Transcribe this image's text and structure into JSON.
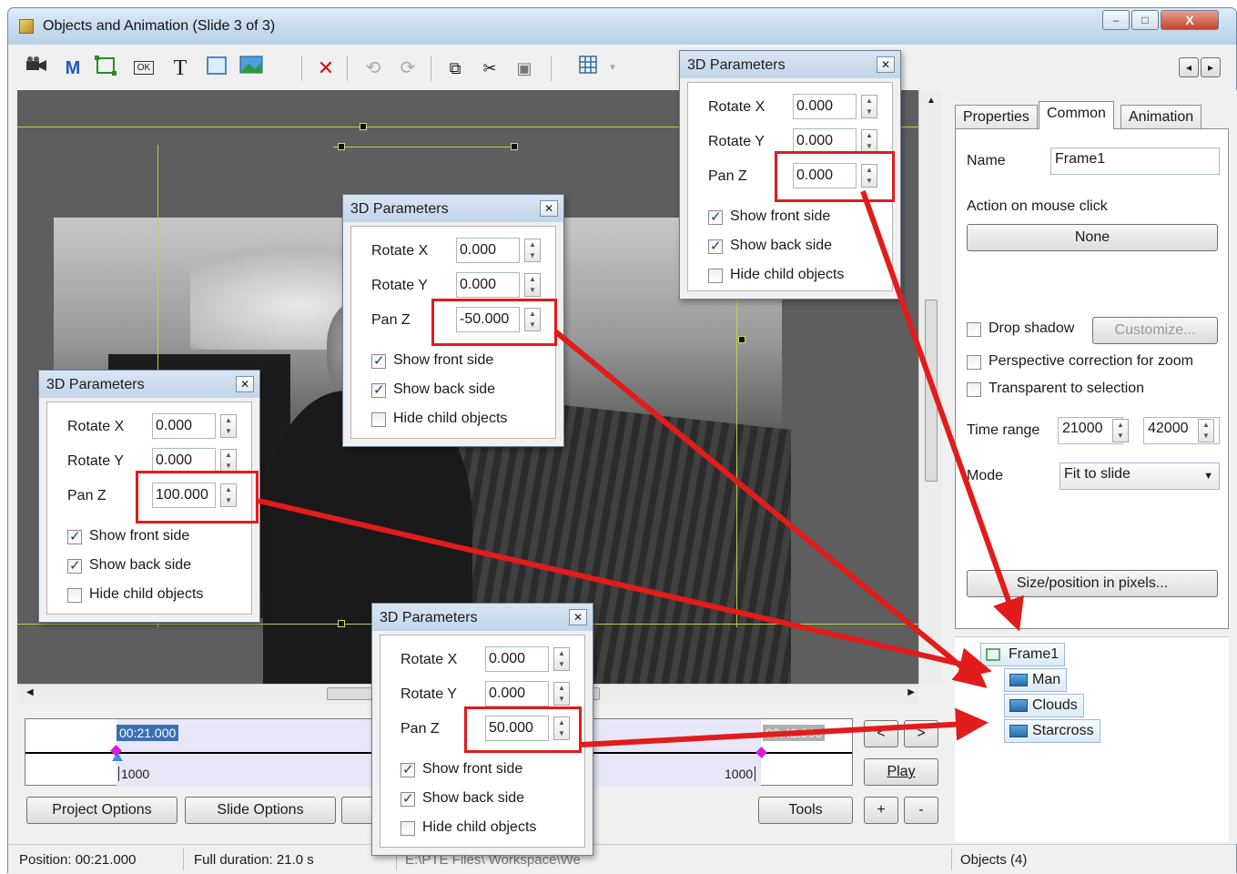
{
  "window": {
    "title": "Objects and Animation  (Slide 3 of 3)",
    "min_label": "–",
    "max_label": "□",
    "close_label": "X"
  },
  "toolbar": {
    "icons": [
      "video-camera-icon",
      "mask-icon",
      "frame-icon",
      "button-icon",
      "text-icon",
      "rectangle-icon",
      "image-icon",
      "delete-icon",
      "undo-icon",
      "redo-icon",
      "copy-icon",
      "cut-icon",
      "paste-icon",
      "grid-icon"
    ],
    "mask_glyph": "M",
    "text_glyph": "T",
    "ok_glyph": "OK",
    "delete_glyph": "✕",
    "nav_prev": "◂",
    "nav_next": "▸"
  },
  "timeline": {
    "start_time": "00:21.000",
    "end_time": "00:42.000",
    "left_value": "1000",
    "right_value": "1000"
  },
  "buttons": {
    "project_options": "Project Options",
    "slide_options": "Slide Options",
    "tools": "Tools",
    "play": "Play",
    "prev": "<",
    "next": ">",
    "plus": "+",
    "minus": "-",
    "none": "None",
    "customize": "Customize...",
    "size_position": "Size/position in pixels..."
  },
  "status": {
    "position": "Position:  00:21.000",
    "duration": "Full duration:  21.0 s",
    "path": "E:\\PTE Files\\ Workspace\\We",
    "objects": "Objects (4)"
  },
  "tabs": [
    "Properties",
    "Common",
    "Animation"
  ],
  "common": {
    "name_label": "Name",
    "name_value": "Frame1",
    "action_label": "Action on mouse click",
    "drop_shadow_label": "Drop shadow",
    "perspective_label": "Perspective correction for zoom",
    "transparent_label": "Transparent to selection",
    "time_range_label": "Time range",
    "time_from": "21000",
    "time_to": "42000",
    "mode_label": "Mode",
    "mode_value": "Fit to slide"
  },
  "tree": [
    {
      "label": "Frame1",
      "icon": "frame-icon"
    },
    {
      "label": "Man",
      "icon": "image-icon"
    },
    {
      "label": "Clouds",
      "icon": "image-icon"
    },
    {
      "label": "Starcross",
      "icon": "image-icon"
    }
  ],
  "dialogs": [
    {
      "title": "3D Parameters",
      "rotate_x_label": "Rotate X",
      "rotate_x": "0.000",
      "rotate_y_label": "Rotate Y",
      "rotate_y": "0.000",
      "pan_z_label": "Pan Z",
      "pan_z": "0.000",
      "show_front_label": "Show front side",
      "show_back_label": "Show back side",
      "hide_child_label": "Hide child objects",
      "show_front": true,
      "show_back": true,
      "hide_child": false
    },
    {
      "title": "3D Parameters",
      "rotate_x_label": "Rotate X",
      "rotate_x": "0.000",
      "rotate_y_label": "Rotate Y",
      "rotate_y": "0.000",
      "pan_z_label": "Pan Z",
      "pan_z": "-50.000",
      "show_front_label": "Show front side",
      "show_back_label": "Show back side",
      "hide_child_label": "Hide child objects",
      "show_front": true,
      "show_back": true,
      "hide_child": false
    },
    {
      "title": "3D Parameters",
      "rotate_x_label": "Rotate X",
      "rotate_x": "0.000",
      "rotate_y_label": "Rotate Y",
      "rotate_y": "0.000",
      "pan_z_label": "Pan Z",
      "pan_z": "100.000",
      "show_front_label": "Show front side",
      "show_back_label": "Show back side",
      "hide_child_label": "Hide child objects",
      "show_front": true,
      "show_back": true,
      "hide_child": false
    },
    {
      "title": "3D Parameters",
      "rotate_x_label": "Rotate X",
      "rotate_x": "0.000",
      "rotate_y_label": "Rotate Y",
      "rotate_y": "0.000",
      "pan_z_label": "Pan Z",
      "pan_z": "50.000",
      "show_front_label": "Show front side",
      "show_back_label": "Show back side",
      "hide_child_label": "Hide child objects",
      "show_front": true,
      "show_back": true,
      "hide_child": false
    }
  ],
  "colors": {
    "annotation_red": "#e21b1b",
    "guide_green": "#b7d548",
    "selection_blue": "#3a6fb2"
  }
}
